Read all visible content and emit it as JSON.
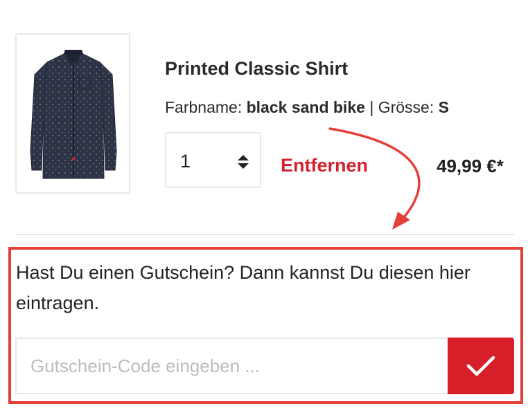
{
  "product": {
    "title": "Printed Classic Shirt",
    "color_label": "Farbname:",
    "color_value": "black sand bike",
    "separator": "|",
    "size_label": "Grösse:",
    "size_value": "S",
    "quantity": "1",
    "remove_label": "Entfernen",
    "price": "49,99 €*"
  },
  "coupon": {
    "prompt": "Hast Du einen Gutschein? Dann kannst Du diesen hier eintragen.",
    "placeholder": "Gutschein-Code eingeben ...",
    "submit_icon": "checkmark-icon"
  },
  "colors": {
    "accent_red": "#d71f2a",
    "annotation_red": "#e53f3a",
    "border_gray": "#e3e8e8"
  }
}
